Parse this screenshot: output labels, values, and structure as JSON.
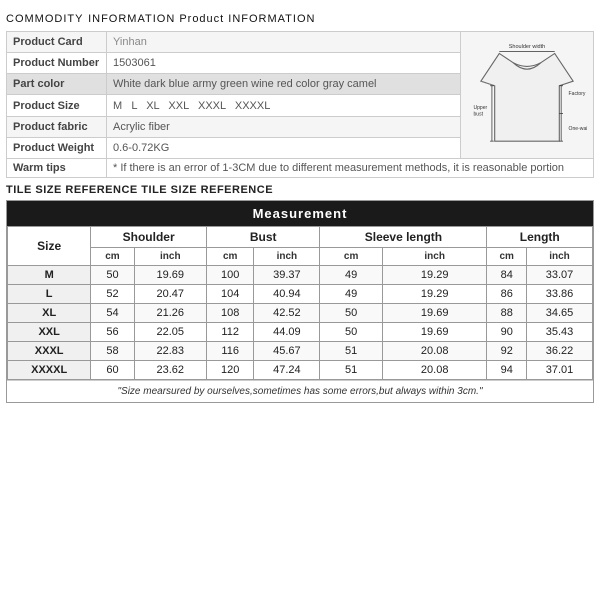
{
  "header": {
    "commodity": "COMMODITY",
    "subtitle": "INFORMATION Product INFORMATION"
  },
  "product_info": {
    "rows": [
      {
        "label": "Product Card",
        "value": "Yinhan",
        "style": "normal"
      },
      {
        "label": "Product Number",
        "value": "1503061",
        "style": "normal"
      },
      {
        "label": "Part color",
        "value": "White dark blue army green wine red color gray camel",
        "style": "highlight"
      },
      {
        "label": "Product Size",
        "value": "M  L  XL  XXL  XXXL  XXXXL",
        "style": "normal"
      },
      {
        "label": "Product fabric",
        "value": "Acrylic fiber",
        "style": "normal"
      },
      {
        "label": "Product Weight",
        "value": "0.6-0.72KG",
        "style": "normal"
      },
      {
        "label": "Warm tips",
        "value": "* If there is an error of 1-3CM due to different measurement methods, it is reasonable portion",
        "style": "tips"
      }
    ]
  },
  "diagram": {
    "labels": {
      "shoulder_width": "Shoulder width",
      "factory_bust": "Factory bust",
      "one_waist": "One-waist",
      "upper_bust": "Upper bust"
    }
  },
  "tile_ref": {
    "text": "TILE SIZE REFERENCE TILE SIZE REFERENCE"
  },
  "measurement": {
    "title": "Measurement",
    "col_groups": [
      "Shoulder",
      "Bust",
      "Sleeve length",
      "Length"
    ],
    "sub_cols": [
      "cm",
      "inch",
      "cm",
      "inch",
      "cm",
      "inch",
      "cm",
      "inch"
    ],
    "rows": [
      {
        "size": "M",
        "shoulder_cm": "50",
        "shoulder_in": "19.69",
        "bust_cm": "100",
        "bust_in": "39.37",
        "sleeve_cm": "49",
        "sleeve_in": "19.29",
        "length_cm": "84",
        "length_in": "33.07"
      },
      {
        "size": "L",
        "shoulder_cm": "52",
        "shoulder_in": "20.47",
        "bust_cm": "104",
        "bust_in": "40.94",
        "sleeve_cm": "49",
        "sleeve_in": "19.29",
        "length_cm": "86",
        "length_in": "33.86"
      },
      {
        "size": "XL",
        "shoulder_cm": "54",
        "shoulder_in": "21.26",
        "bust_cm": "108",
        "bust_in": "42.52",
        "sleeve_cm": "50",
        "sleeve_in": "19.69",
        "length_cm": "88",
        "length_in": "34.65"
      },
      {
        "size": "XXL",
        "shoulder_cm": "56",
        "shoulder_in": "22.05",
        "bust_cm": "112",
        "bust_in": "44.09",
        "sleeve_cm": "50",
        "sleeve_in": "19.69",
        "length_cm": "90",
        "length_in": "35.43"
      },
      {
        "size": "XXXL",
        "shoulder_cm": "58",
        "shoulder_in": "22.83",
        "bust_cm": "116",
        "bust_in": "45.67",
        "sleeve_cm": "51",
        "sleeve_in": "20.08",
        "length_cm": "92",
        "length_in": "36.22"
      },
      {
        "size": "XXXXL",
        "shoulder_cm": "60",
        "shoulder_in": "23.62",
        "bust_cm": "120",
        "bust_in": "47.24",
        "sleeve_cm": "51",
        "sleeve_in": "20.08",
        "length_cm": "94",
        "length_in": "37.01"
      }
    ],
    "note": "\"Size mearsured by ourselves,sometimes has some errors,but always within 3cm.\""
  }
}
